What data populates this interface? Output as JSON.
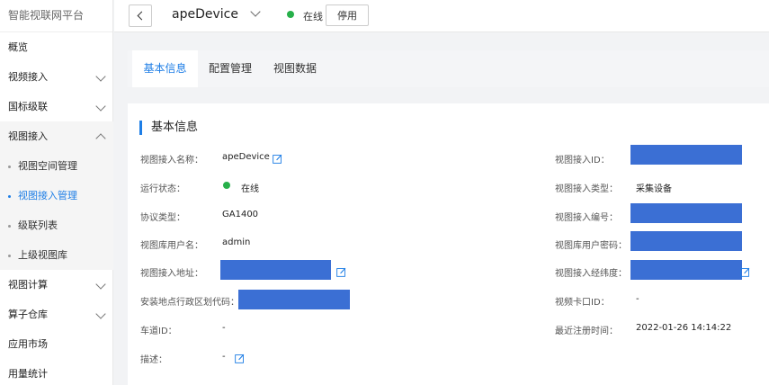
{
  "brand": "智能视联网平台",
  "sidebar": {
    "items": [
      {
        "label": "概览"
      },
      {
        "label": "视频接入"
      },
      {
        "label": "国标级联"
      },
      {
        "label": "视图接入"
      },
      {
        "label": "视图空间管理"
      },
      {
        "label": "视图接入管理"
      },
      {
        "label": "级联列表"
      },
      {
        "label": "上级视图库"
      },
      {
        "label": "视图计算"
      },
      {
        "label": "算子仓库"
      },
      {
        "label": "应用市场"
      },
      {
        "label": "用量统计"
      }
    ]
  },
  "header": {
    "device_name": "apeDevice",
    "status": "在线",
    "stop_label": "停用"
  },
  "tabs": [
    {
      "label": "基本信息"
    },
    {
      "label": "配置管理"
    },
    {
      "label": "视图数据"
    }
  ],
  "section": {
    "title": "基本信息",
    "left": [
      {
        "label": "视图接入名称：",
        "value": "apeDevice"
      },
      {
        "label": "运行状态：",
        "value": "在线"
      },
      {
        "label": "协议类型：",
        "value": "GA1400"
      },
      {
        "label": "视图库用户名：",
        "value": "admin"
      },
      {
        "label": "视图接入地址：",
        "value": ""
      },
      {
        "label": "安装地点行政区划代码：",
        "value": ""
      },
      {
        "label": "车道ID：",
        "value": "-"
      },
      {
        "label": "描述：",
        "value": "-"
      }
    ],
    "right": [
      {
        "label": "视图接入ID：",
        "value": ""
      },
      {
        "label": "视图接入类型：",
        "value": "采集设备"
      },
      {
        "label": "视图接入编号：",
        "value": ""
      },
      {
        "label": "视图库用户密码：",
        "value": ""
      },
      {
        "label": "视图接入经纬度：",
        "value": ""
      },
      {
        "label": "视频卡口ID：",
        "value": "-"
      },
      {
        "label": "最近注册时间：",
        "value": "2022-01-26 14:14:22"
      }
    ]
  },
  "colors": {
    "accent": "#1e7ee6",
    "online": "#27b04a",
    "redaction": "#3b6fd4"
  }
}
